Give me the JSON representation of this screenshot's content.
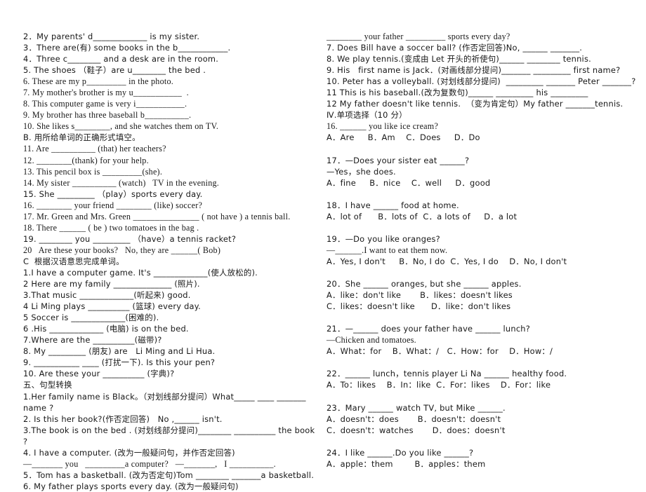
{
  "document": {
    "type": "worksheet",
    "language": "en-zh",
    "page_background": "#ffffff",
    "text_color": "#171717"
  },
  "left_column": {
    "lines": [
      "2．My parents' d_____________ is my sister.",
      "3．There are(有) some books in the b____________.",
      "4．Three c________ and a desk are in the room.",
      "5. The shoes （鞋子）are u________ the bed .",
      "6. These are my p_________ in the photo.",
      "7. My mother's brother is my u___________  .",
      "8. This computer game is very i___________.",
      "9. My brother has three baseball b__________.",
      "10. She likes s________, and she watches them on TV.",
      "B. 用所给单词的正确形式填空。",
      "11. Are __________ (that) her teachers?",
      "12. ________(thank) for your help.",
      "13. This pencil box is _________(she).",
      "14. My sister __________ (watch)   TV in the evening.",
      "15. She _________ （play）sports every day.",
      "16. ________ your friend ________ (like) soccer?",
      "17. Mr. Green and Mrs. Green _______________ ( not have ) a tennis ball.",
      "18. There ______ ( be ) two tomatoes in the bag .",
      "19. ________ you _________ （have）a tennis racket?",
      "20   Are these your books?   No, they are ______( Bob)",
      "C  根据汉语意思完成单词。",
      "1.I have a computer game. It's _____________(使人放松的).",
      "2 Here are my family ______________ (照片).",
      "3.That music _____________(听起来) good.",
      "4 Li Ming plays __________ (篮球) every day.",
      "5 Soccer is _____________(困难的).",
      "6 .His _____________ (电脑) is on the bed.",
      "7.Where are the __________(磁带)?",
      "8. My _________ (朋友) are   Li Ming and Li Hua.",
      "9. ___________ ____ (打扰一下). Is this your pen?",
      "10. Are these your __________ (字典)?",
      "五、句型转换",
      "1.Her family name is Black。（对划线部分提问）What_____ ____ _______ name ?",
      "2. Is this her book?(作否定回答)   No ,______ isn't.",
      "3.The book is on the bed . (对划线部分提问)________ __________ the book ?",
      "4. I have a computer. (改为一般疑问句，并作否定回答)",
      "—_______ you   _________a computer?   —_______,   I __________.",
      "5．Tom has a basketball. (改为否定句)Tom ________ _______a basketball.",
      "6. My father plays sports every day. (改为一般疑问句)"
    ]
  },
  "right_column": {
    "lines": [
      "________ your father _________ sports every day?",
      "7. Does Bill have a soccer ball? (作否定回答)No, ______ _______.",
      "8. We play tennis.(变成由 Let 开头的祈使句)______ ________ tennis.",
      "9. His   first name is Jack．(对画线部分提问)_______ _________ first name?",
      "10. Peter has a volleyball. (对划线部分提问)  _________ _______ Peter _______?",
      "11 This is his baseball.(改为复数句)______ _________ his _________",
      "12 My father doesn't like tennis.  （变为肯定句）My father _______tennis.",
      "Ⅳ.单项选择（10 分）",
      "16. ______ you like ice cream?",
      "A．Are     B．Am    C．Does     D．Do",
      "",
      "17．—Does your sister eat ______?",
      "—Yes，she does.",
      "A．fine     B．nice    C．well     D．good",
      "",
      "18．I have ______ food at home.",
      "A．lot of      B．lots of  C．a lots of     D．a lot",
      "",
      "19．—Do you like oranges?",
      "—______.I want to eat them now.",
      "A．Yes, I don't     B．No, I do  C．Yes, I do    D．No, I don't",
      "",
      "20．She ______ oranges, but she ______ apples.",
      "A．like：don't like       B．likes：doesn't likes",
      "C．likes：doesn't like      D．like：don't likes",
      "",
      "21．—______ does your father have ______ lunch?",
      "—Chicken and tomatoes.",
      "A．What：for    B．What：/   C．How：for    D．How：/",
      "",
      "22．______ lunch，tennis player Li Na ______ healthy food.",
      "A．To：likes    B．In：like  C．For：likes    D．For：like",
      "",
      "23．Mary ______ watch TV, but Mike ______.",
      "A．doesn't：does       B．doesn't：doesn't",
      "C．doesn't：watches       D．does：doesn't",
      "",
      "24．I like ______.Do you like ______?",
      "A．apple：them        B．apples：them"
    ]
  }
}
